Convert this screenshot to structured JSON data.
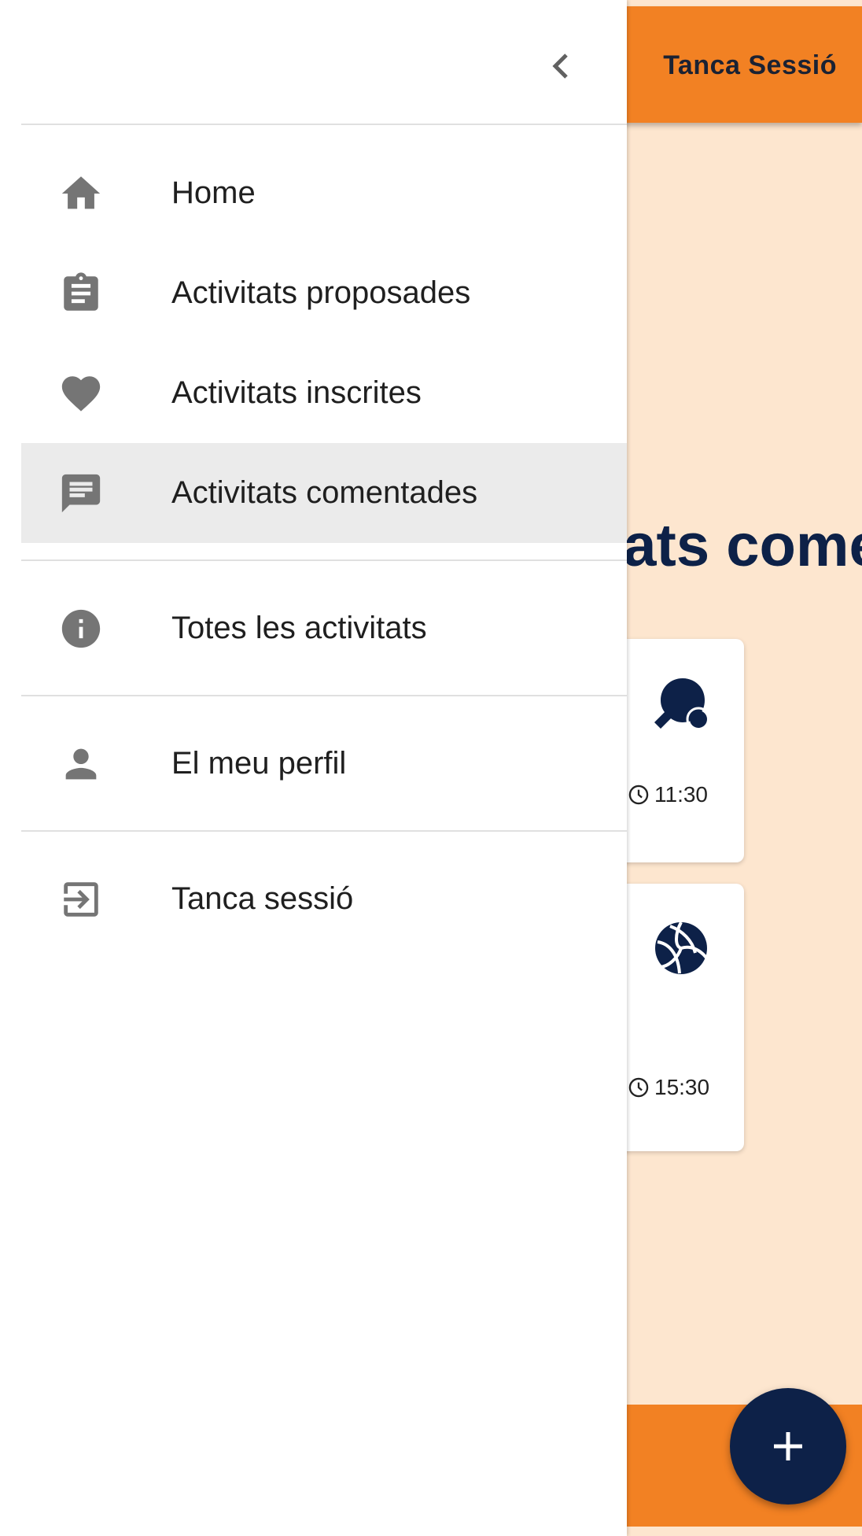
{
  "app": {
    "topbar_button": "Tanca Sessió",
    "page_heading": "Activitats comentades",
    "cards": [
      {
        "icon": "ping-pong-icon",
        "time": "11:30"
      },
      {
        "icon": "volleyball-icon",
        "time": "15:30"
      }
    ],
    "fab_icon": "plus-icon"
  },
  "drawer": {
    "collapse_icon": "chevron-left-icon",
    "items": [
      {
        "label": "Home",
        "icon": "home-icon"
      },
      {
        "label": "Activitats proposades",
        "icon": "clipboard-icon"
      },
      {
        "label": "Activitats inscrites",
        "icon": "heart-icon"
      },
      {
        "label": "Activitats comentades",
        "icon": "comment-icon",
        "active": true
      },
      {
        "label": "Totes les activitats",
        "icon": "info-icon"
      },
      {
        "label": "El meu perfil",
        "icon": "person-icon"
      },
      {
        "label": "Tanca sessió",
        "icon": "exit-icon"
      }
    ]
  },
  "colors": {
    "accent": "#f28123",
    "primary": "#0d2148",
    "background": "#fde6cf",
    "drawer_icon": "#757575",
    "active_item_bg": "#ebebeb"
  }
}
